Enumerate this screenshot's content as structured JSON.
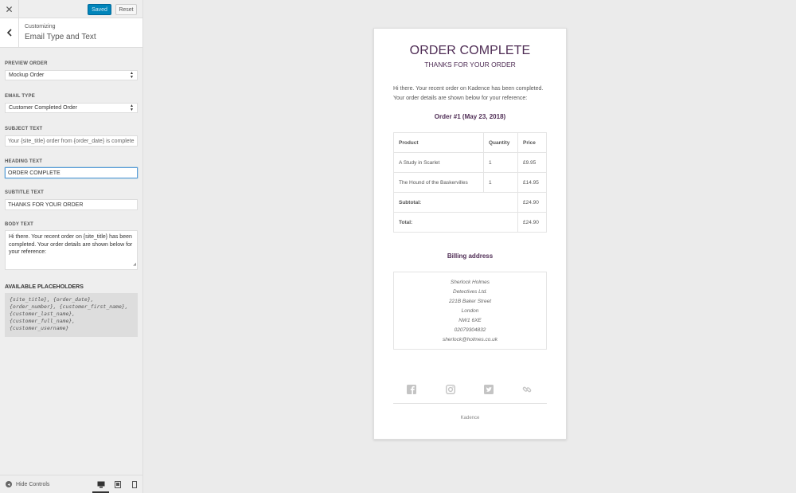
{
  "topbar": {
    "close_icon": "close-icon",
    "saved_label": "Saved",
    "reset_label": "Reset"
  },
  "section": {
    "crumb": "Customizing",
    "title": "Email Type and Text"
  },
  "controls": {
    "preview_order": {
      "label": "PREVIEW ORDER",
      "value": "Mockup Order"
    },
    "email_type": {
      "label": "EMAIL TYPE",
      "value": "Customer Completed Order"
    },
    "subject_text": {
      "label": "SUBJECT TEXT",
      "placeholder": "Your {site_title} order from {order_date} is complete"
    },
    "heading_text": {
      "label": "HEADING TEXT",
      "value": "ORDER COMPLETE"
    },
    "subtitle_text": {
      "label": "SUBTITLE TEXT",
      "value": "THANKS FOR YOUR ORDER"
    },
    "body_text": {
      "label": "BODY TEXT",
      "value": "Hi there. Your recent order on {site_title} has been completed. Your order details are shown below for your reference:"
    },
    "placeholders": {
      "label": "AVAILABLE PLACEHOLDERS",
      "lines": [
        "{site_title}, {order_date},",
        "{order_number}, {customer_first_name},",
        "{customer_last_name},",
        "{customer_full_name},",
        "{customer_username}"
      ]
    }
  },
  "bottombar": {
    "hide_controls": "Hide Controls",
    "devices": [
      "desktop-icon",
      "tablet-icon",
      "mobile-icon"
    ]
  },
  "email": {
    "heading": "ORDER COMPLETE",
    "subtitle": "THANKS FOR YOUR ORDER",
    "body_line1": "Hi there. Your recent order on Kadence has been completed.",
    "body_line2": "Your order details are shown below for your reference:",
    "order_title": "Order #1 (May 23, 2018)",
    "table": {
      "headers": [
        "Product",
        "Quantity",
        "Price"
      ],
      "rows": [
        {
          "product": "A Study in Scarlet",
          "quantity": "1",
          "price": "£9.95"
        },
        {
          "product": "The Hound of the Baskervilles",
          "quantity": "1",
          "price": "£14.95"
        }
      ],
      "subtotal_label": "Subtotal:",
      "subtotal_value": "£24.90",
      "total_label": "Total:",
      "total_value": "£24.90"
    },
    "billing_title": "Billing address",
    "address": [
      "Sherlock Holmes",
      "Detectives Ltd.",
      "221B Baker Street",
      "London",
      "NW1 6XE",
      "02079304832",
      "sherlock@holmes.co.uk"
    ],
    "socials": [
      "facebook-icon",
      "instagram-icon",
      "twitter-icon",
      "link-icon"
    ],
    "footer": "Kadence"
  },
  "colors": {
    "accent": "#0085ba",
    "heading": "#4f2d55"
  }
}
